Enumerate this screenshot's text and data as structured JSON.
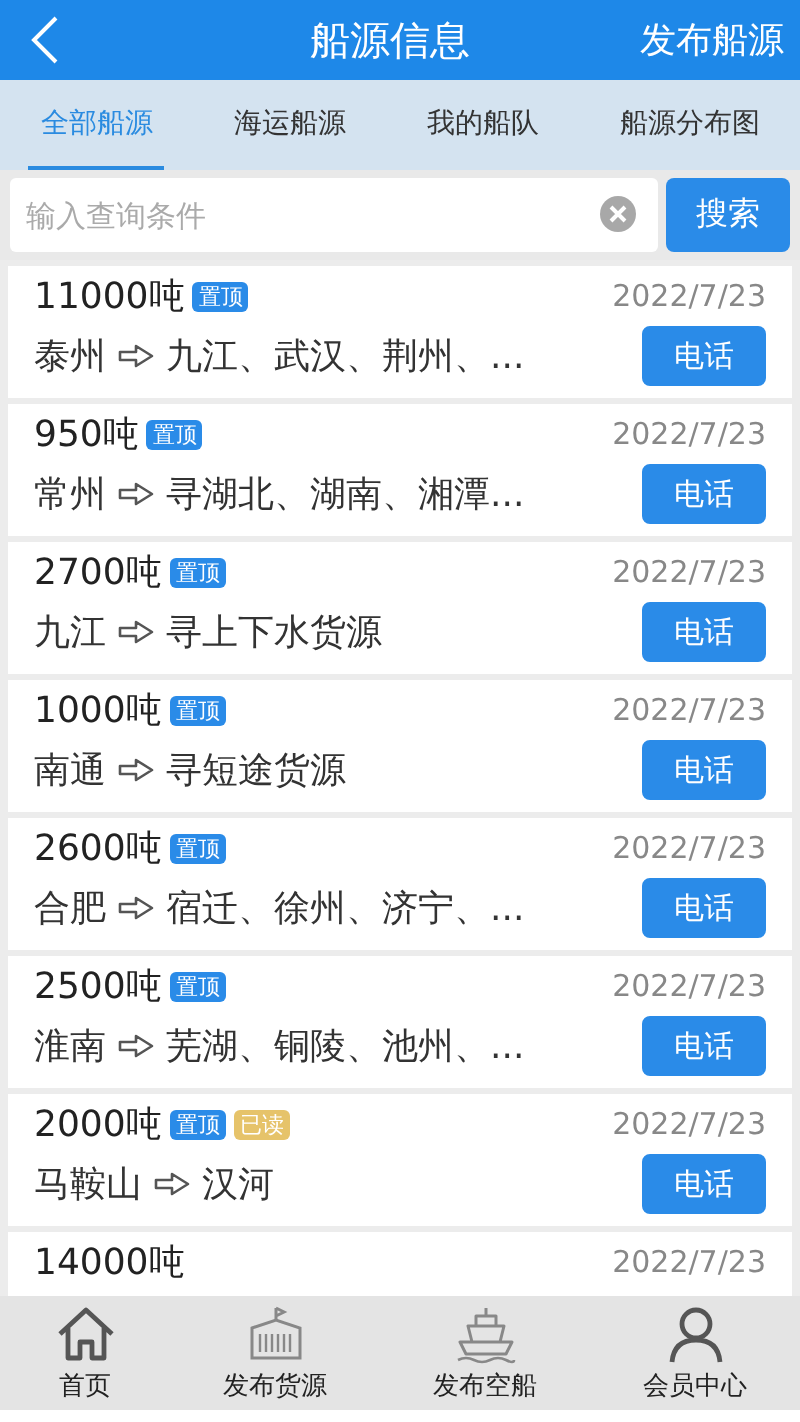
{
  "header": {
    "title": "船源信息",
    "action": "发布船源"
  },
  "tabs": [
    {
      "label": "全部船源",
      "selected": true
    },
    {
      "label": "海运船源",
      "selected": false
    },
    {
      "label": "我的船队",
      "selected": false
    },
    {
      "label": "船源分布图",
      "selected": false
    }
  ],
  "search": {
    "placeholder": "输入查询条件",
    "button": "搜索"
  },
  "listings": [
    {
      "tonnage": "11000吨",
      "tags": [
        {
          "kind": "pinned",
          "label": "置顶"
        }
      ],
      "date": "2022/7/23",
      "from": "泰州",
      "to": "九江、武汉、荆州、...",
      "button": "电话"
    },
    {
      "tonnage": "950吨",
      "tags": [
        {
          "kind": "pinned",
          "label": "置顶"
        }
      ],
      "date": "2022/7/23",
      "from": "常州",
      "to": "寻湖北、湖南、湘潭...",
      "button": "电话"
    },
    {
      "tonnage": "2700吨",
      "tags": [
        {
          "kind": "pinned",
          "label": "置顶"
        }
      ],
      "date": "2022/7/23",
      "from": "九江",
      "to": "寻上下水货源",
      "button": "电话"
    },
    {
      "tonnage": "1000吨",
      "tags": [
        {
          "kind": "pinned",
          "label": "置顶"
        }
      ],
      "date": "2022/7/23",
      "from": "南通",
      "to": "寻短途货源",
      "button": "电话"
    },
    {
      "tonnage": "2600吨",
      "tags": [
        {
          "kind": "pinned",
          "label": "置顶"
        }
      ],
      "date": "2022/7/23",
      "from": "合肥",
      "to": "宿迁、徐州、济宁、...",
      "button": "电话"
    },
    {
      "tonnage": "2500吨",
      "tags": [
        {
          "kind": "pinned",
          "label": "置顶"
        }
      ],
      "date": "2022/7/23",
      "from": "淮南",
      "to": "芜湖、铜陵、池州、...",
      "button": "电话"
    },
    {
      "tonnage": "2000吨",
      "tags": [
        {
          "kind": "pinned",
          "label": "置顶"
        },
        {
          "kind": "read",
          "label": "已读"
        }
      ],
      "date": "2022/7/23",
      "from": "马鞍山",
      "to": "汉河",
      "button": "电话"
    },
    {
      "tonnage": "14000吨",
      "date": "2022/7/23"
    }
  ],
  "bottom_nav": [
    {
      "kind": "home",
      "label": "首页"
    },
    {
      "kind": "container",
      "label": "发布货源"
    },
    {
      "kind": "ship",
      "label": "发布空船"
    },
    {
      "kind": "person",
      "label": "会员中心"
    }
  ]
}
